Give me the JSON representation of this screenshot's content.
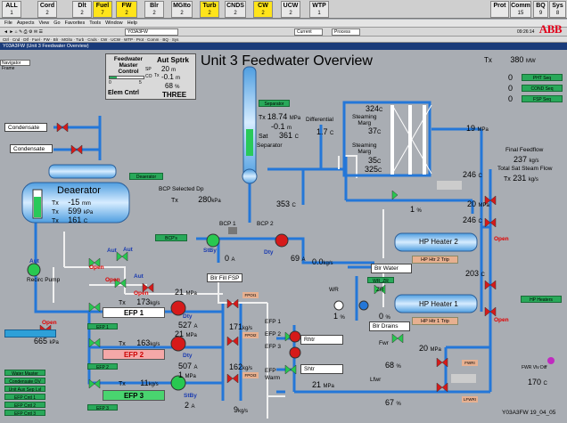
{
  "alarm_bar": [
    {
      "label": "ALL",
      "count": "1",
      "hot": false
    },
    {
      "label": "Cord",
      "count": "2",
      "hot": false
    },
    {
      "label": "Dlt",
      "count": "2",
      "hot": false
    },
    {
      "label": "Fuel",
      "count": "7",
      "hot": true
    },
    {
      "label": "FW",
      "count": "2",
      "hot": true
    },
    {
      "label": "Blr",
      "count": "2",
      "hot": false
    },
    {
      "label": "MGIto",
      "count": "2",
      "hot": false
    },
    {
      "label": "Turb",
      "count": "2",
      "hot": true
    },
    {
      "label": "CNDS",
      "count": "2",
      "hot": false
    },
    {
      "label": "CW",
      "count": "2",
      "hot": true
    },
    {
      "label": "UCW",
      "count": "2",
      "hot": false
    },
    {
      "label": "WTP",
      "count": "1",
      "hot": false
    },
    {
      "label": "Prot",
      "count": "",
      "hot": false
    },
    {
      "label": "Comm",
      "count": "15",
      "hot": false
    },
    {
      "label": "BQ",
      "count": "9",
      "hot": false
    },
    {
      "label": "Sys",
      "count": "8",
      "hot": false
    }
  ],
  "menu": [
    "File",
    "Aspects",
    "View",
    "Go",
    "Favorites",
    "Tools",
    "Window",
    "Help"
  ],
  "toolbar": {
    "display": "Y03A3FW",
    "combo1": "Current",
    "combo2": "Process",
    "time": "09:26:14"
  },
  "window_title": "Y03A3FW (Unit 3 Feedwater Overview)",
  "nav_frame": "Navigator Frame",
  "page_title": "Unit 3 Feedwater Overview",
  "brand": "ABB",
  "master": {
    "title1": "Feedwater",
    "title2": "Master",
    "title3": "Control",
    "scale_lo": "0",
    "scale_hi": "5",
    "sp": "SP",
    "co": "CO",
    "elem": "Elem Cntrl"
  },
  "aut_sptrk": {
    "title": "Aut Sptrk",
    "v1": "20",
    "u1": "m",
    "v2": "-0.1",
    "u2": "m",
    "v3": "68",
    "u3": "%",
    "mode": "THREE"
  },
  "tx_top": {
    "label": "Tx",
    "value": "380",
    "unit": "MW"
  },
  "seq": [
    "PHT Seq",
    "COND Seq",
    "FSP Seq"
  ],
  "seq_values": [
    "0",
    "0",
    "0"
  ],
  "separator": {
    "name": "Separator",
    "tx": "18.74",
    "tx_u": "MPa",
    "tx2": "-0.1",
    "tx2_u": "m",
    "sat": "Sat",
    "sat_v": "361",
    "sat_u": "C",
    "label": "Separator"
  },
  "differential": {
    "label": "Differential",
    "value": "1.7",
    "unit": "C"
  },
  "steaming": {
    "v1": "324",
    "u1": "C",
    "label1a": "Steaming",
    "label1b": "Marg",
    "v2": "37",
    "u2": "C",
    "label2a": "Steaming",
    "label2b": "Marg",
    "v3": "35",
    "u3": "C",
    "v4": "325",
    "u4": "C"
  },
  "mpa19": {
    "value": "19",
    "unit": "MPa"
  },
  "final_feedflow": {
    "label": "Final Feedflow",
    "value": "237",
    "unit": "kg/s",
    "label2": "Total Sat Steam Flow",
    "tx": "Tx",
    "value2": "231",
    "unit2": "kg/s"
  },
  "condensate": [
    "Condensate",
    "Condensate"
  ],
  "deaerator": {
    "tag": "Deaerator",
    "name": "Deaerator",
    "tx1": "-15",
    "u1": "mm",
    "tx2": "599",
    "u2": "kPa",
    "tx3": "161",
    "u3": "C"
  },
  "bcp": {
    "selected_dp": "BCP Selected Dp",
    "tx": "Tx",
    "dp": "280",
    "dp_u": "kPa",
    "temp": "353",
    "temp_u": "C",
    "bcp1": "BCP 1",
    "bcp2": "BCP 2",
    "amp1": "0",
    "amp1_u": "A",
    "amp2": "69",
    "amp2_u": "A",
    "flow": "0.0",
    "flow_u": "kg/s",
    "stby": "StBy",
    "dty": "Dty",
    "tag": "BCP's"
  },
  "pct1": {
    "value": "1",
    "unit": "%"
  },
  "mpa20": {
    "value": "20",
    "unit": "MPa"
  },
  "t246": {
    "value": "246",
    "unit": "C"
  },
  "t246b": {
    "value": "246",
    "unit": "C"
  },
  "hp2": {
    "name": "HP Heater 2",
    "trip": "HP Htr 2 Trip",
    "open": "Open",
    "temp": "203",
    "temp_u": "C"
  },
  "hp1": {
    "name": "HP Heater 1",
    "trip": "HP Htr 1 Trip",
    "open": "Open",
    "tag": "HP Heaters"
  },
  "blr_water": "Blr Water",
  "blr_drains": "Blr Drains",
  "blr_fill": "Blr Fill FSP",
  "wr": {
    "wr": "WR",
    "zr": "ZR",
    "pct": "1",
    "pct_u": "%",
    "pct2": "0",
    "pct2_u": "%",
    "tag": "WR_ZR"
  },
  "aut_labels": [
    "Aut",
    "Aut",
    "Aut",
    "Aut"
  ],
  "recirc_pump": "Recirc Pump",
  "open_labels": [
    "Open",
    "Open",
    "Open",
    "Open"
  ],
  "kpa665": {
    "value": "665",
    "unit": "kPa"
  },
  "efp1": {
    "tx": "Tx",
    "flow": "173",
    "flow_u": "kg/s",
    "name": "EFP 1",
    "amp": "527",
    "amp_u": "A",
    "mpa": "21",
    "mpa_u": "MPa",
    "dty": "Dty",
    "tag": "EFP 1",
    "fpoi": "FPOI1",
    "flow2": "171",
    "flow2_u": "kg/s"
  },
  "efp2": {
    "tx": "Tx",
    "flow": "163",
    "flow_u": "kg/s",
    "name": "EFP 2",
    "amp": "507",
    "amp_u": "A",
    "mpa": "21",
    "mpa_u": "MPa",
    "dty": "Dty",
    "tag": "EFP 2",
    "fpoi": "FPOI2",
    "flow2": "162",
    "flow2_u": "kg/s"
  },
  "efp3": {
    "tx": "Tx",
    "flow": "11",
    "flow_u": "kg/s",
    "name": "EFP 3",
    "amp": "2",
    "amp_u": "A",
    "mpa": "1",
    "mpa_u": "MPa",
    "stby": "StBy",
    "tag": "EFP 3",
    "fpoi": "FPOI3",
    "flow2": "9",
    "flow2_u": "kg/s"
  },
  "efp_warm": [
    "EFP 1",
    "EFP 2",
    "EFP 3",
    "EFP",
    "Warm"
  ],
  "rhtr": "Rhtr",
  "shtr": "Shtr",
  "mpa21b": {
    "value": "21",
    "unit": "MPa"
  },
  "fwr": {
    "label": "Fwr",
    "value": "68",
    "unit": "%",
    "mpa": "20",
    "mpa_u": "MPa",
    "tag": "FWRI"
  },
  "lfwr": {
    "label": "Lfwr",
    "value": "67",
    "unit": "%",
    "tag": "LFWRI"
  },
  "fwr_vlv": {
    "label": "FWR Vlv Diff",
    "value": "170",
    "unit": "C"
  },
  "bottom_left": [
    "Water Master",
    "Condensate OV",
    "Unit Aux Sep Lvl",
    "EFP Cntl 1",
    "EFP Cntl 2",
    "EFP Cntl 3"
  ],
  "footer": "Y03A3FW 19_04_05"
}
